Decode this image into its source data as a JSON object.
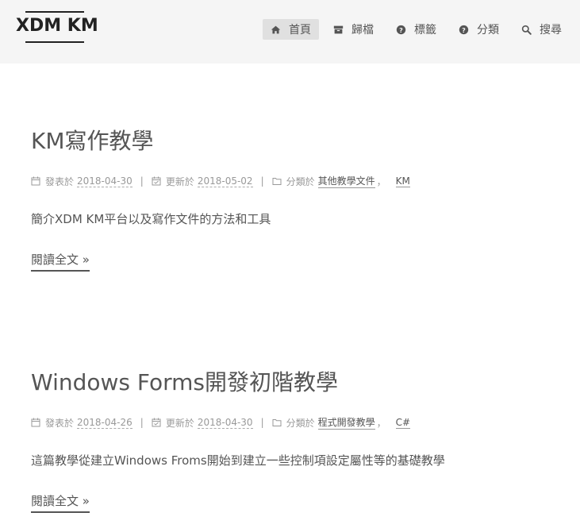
{
  "site": {
    "brand": "XDM KM"
  },
  "nav": [
    {
      "label": "首頁",
      "icon": "home-icon",
      "active": true
    },
    {
      "label": "歸檔",
      "icon": "archive-icon",
      "active": false
    },
    {
      "label": "標籤",
      "icon": "question-circle-icon",
      "active": false
    },
    {
      "label": "分類",
      "icon": "question-circle-icon",
      "active": false
    },
    {
      "label": "搜尋",
      "icon": "search-icon",
      "active": false
    }
  ],
  "posts": [
    {
      "title": "KM寫作教學",
      "posted_label": "發表於",
      "posted_date": "2018-04-30",
      "updated_label": "更新於",
      "updated_date": "2018-05-02",
      "category_label": "分類於",
      "categories": [
        "其他教學文件",
        "KM"
      ],
      "description": "簡介XDM KM平台以及寫作文件的方法和工具",
      "read_more": "閱讀全文 »"
    },
    {
      "title": "Windows Forms開發初階教學",
      "posted_label": "發表於",
      "posted_date": "2018-04-26",
      "updated_label": "更新於",
      "updated_date": "2018-04-30",
      "category_label": "分類於",
      "categories": [
        "程式開發教學",
        "C#"
      ],
      "description": "這篇教學從建立Windows Froms開始到建立一些控制項設定屬性等的基礎教學",
      "read_more": "閱讀全文 »"
    }
  ],
  "meta_separator": "|",
  "category_comma": "，"
}
